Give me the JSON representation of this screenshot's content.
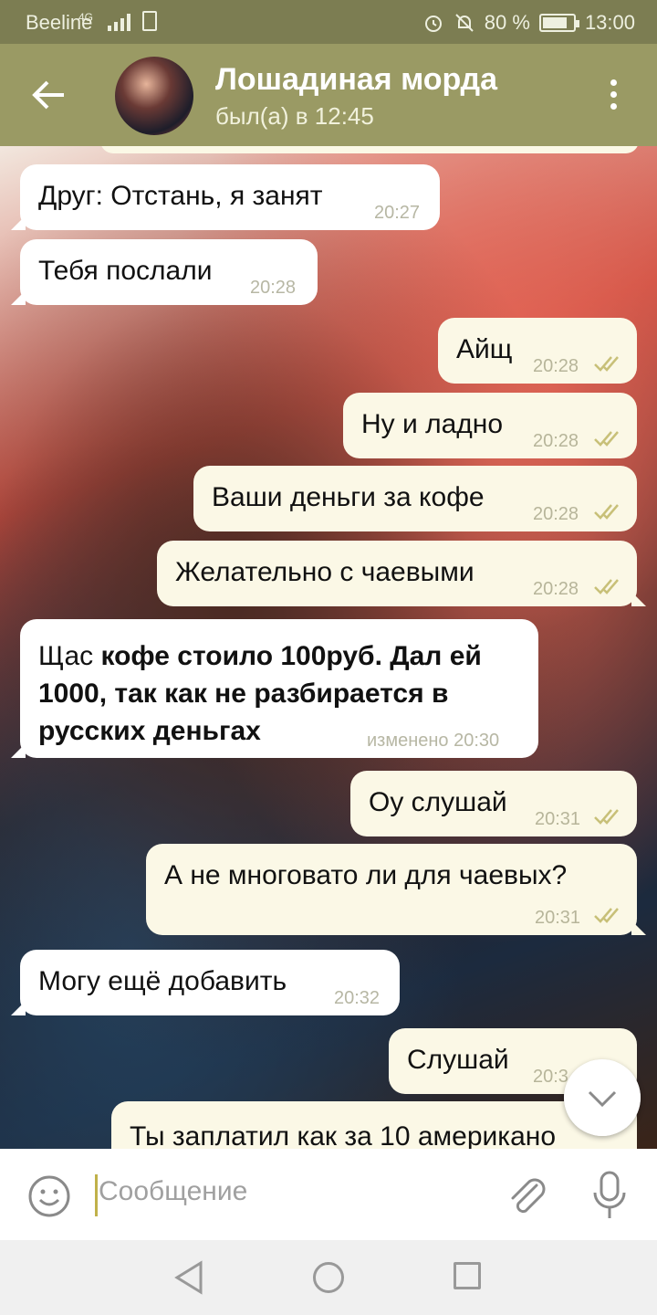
{
  "status_bar": {
    "carrier": "Beeline",
    "network": "4G",
    "battery": "80 %",
    "battery_level": 0.8,
    "time": "13:00"
  },
  "header": {
    "title": "Лошадиная морда",
    "status": "был(а) в 12:45"
  },
  "messages": [
    {
      "dir": "in",
      "text": "Друг: Отстань, я занят",
      "time": "20:27"
    },
    {
      "dir": "in",
      "text": "Тебя послали",
      "time": "20:28"
    },
    {
      "dir": "out",
      "text": "Айщ",
      "time": "20:28",
      "read": true
    },
    {
      "dir": "out",
      "text": "Ну и ладно",
      "time": "20:28",
      "read": true
    },
    {
      "dir": "out",
      "text": "Ваши деньги за кофе",
      "time": "20:28",
      "read": true
    },
    {
      "dir": "out",
      "text": "Желательно с чаевыми",
      "time": "20:28",
      "read": true
    },
    {
      "dir": "in",
      "text_plain": "Щас ",
      "text_bold_1": "кофе стоило 100руб. Дал ей",
      "text_bold_2": "1000, так как не разбирается в",
      "text_bold_3": "русских деньгах",
      "time": "изменено 20:30"
    },
    {
      "dir": "out",
      "text": "Оу слушай",
      "time": "20:31",
      "read": true
    },
    {
      "dir": "out",
      "text": "А не многовато ли для чаевых?",
      "time": "20:31",
      "read": true
    },
    {
      "dir": "in",
      "text": "Могу ещё добавить",
      "time": "20:32"
    },
    {
      "dir": "out",
      "text": "Слушай",
      "time": "20:3"
    },
    {
      "dir": "out",
      "text": "Ты заплатил как за 10 американо"
    }
  ],
  "input": {
    "placeholder": "Сообщение"
  },
  "colors": {
    "header": "#9a9a64",
    "status_bar": "#7c7d52",
    "bubble_out": "#fbf8e6",
    "bubble_in": "#ffffff",
    "read_ticks": "#c8c078"
  },
  "icons": [
    "back-arrow-icon",
    "more-vert-icon",
    "double-check-icon",
    "emoji-icon",
    "attach-icon",
    "mic-icon",
    "chevron-down-icon",
    "nav-back-icon",
    "nav-home-icon",
    "nav-recent-icon"
  ]
}
